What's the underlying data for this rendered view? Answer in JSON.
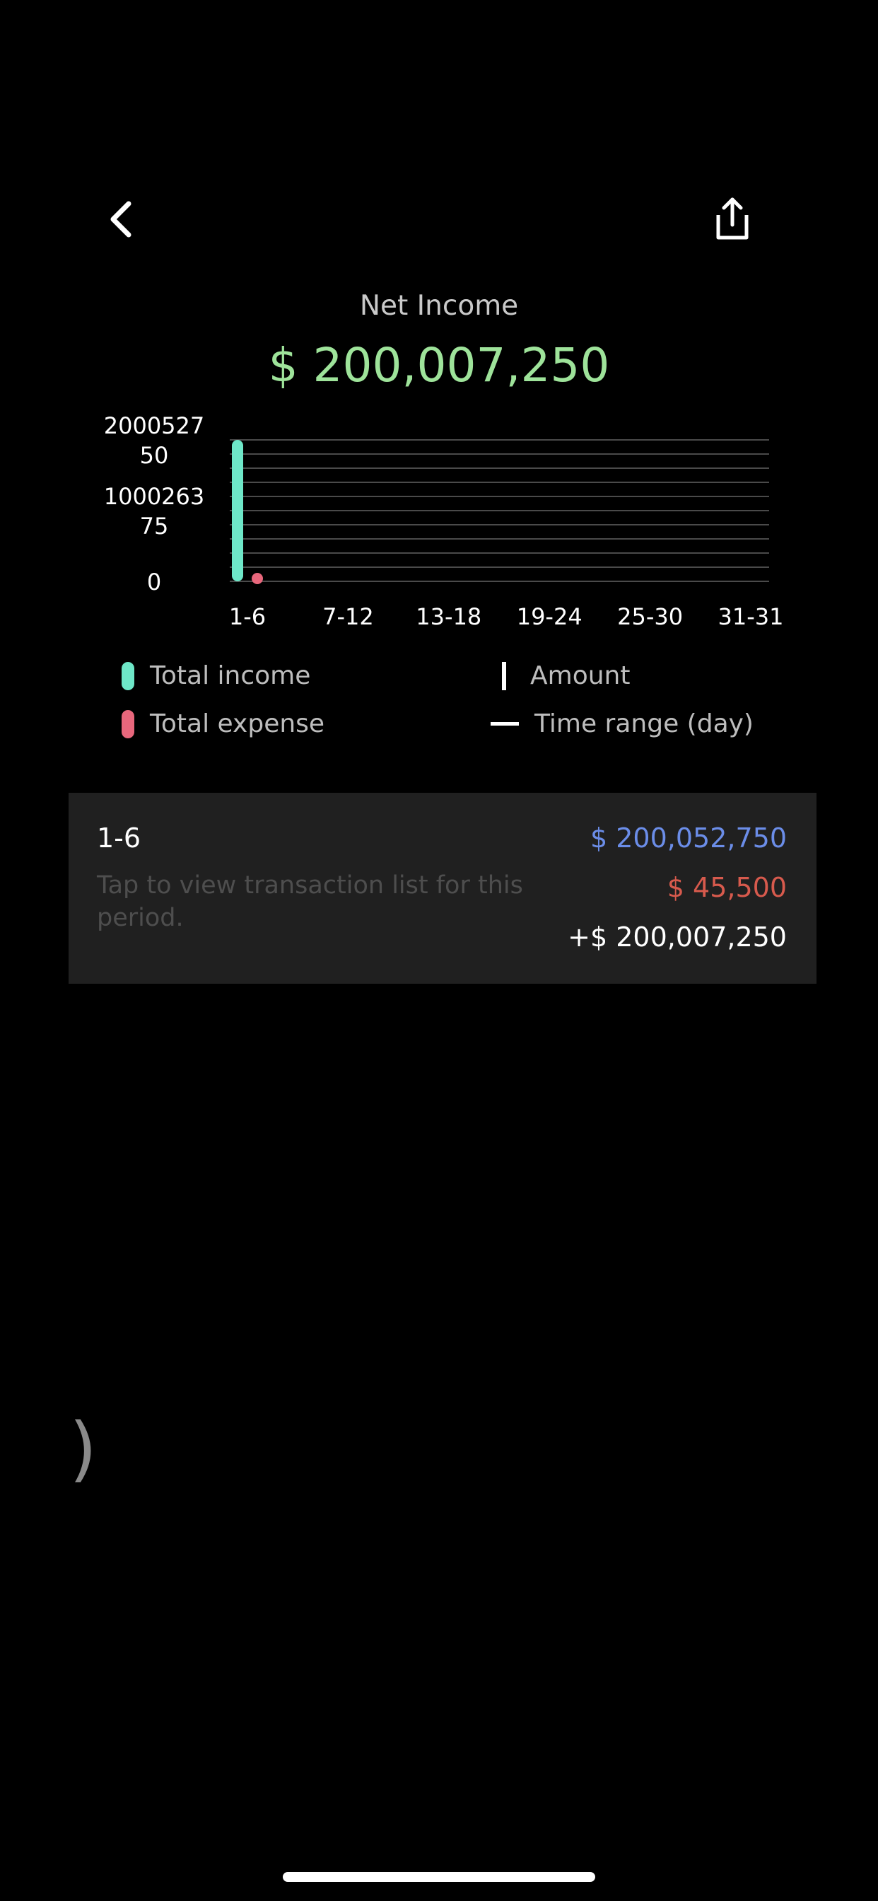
{
  "header": {
    "back_icon": "chevron-left-icon",
    "share_icon": "share-icon"
  },
  "summary": {
    "title": "Net Income",
    "amount": "$ 200,007,250"
  },
  "chart_data": {
    "type": "bar",
    "categories": [
      "1-6",
      "7-12",
      "13-18",
      "19-24",
      "25-30",
      "31-31"
    ],
    "series": [
      {
        "name": "Total income",
        "values": [
          200052750,
          0,
          0,
          0,
          0,
          0
        ],
        "color": "#6ee7c8"
      },
      {
        "name": "Total expense",
        "values": [
          45500,
          0,
          0,
          0,
          0,
          0
        ],
        "color": "#e8677c"
      }
    ],
    "ytick_labels": [
      {
        "value": 200052750,
        "lines": [
          "2000527",
          "50"
        ]
      },
      {
        "value": 100026375,
        "lines": [
          "1000263",
          "75"
        ]
      },
      {
        "value": 0,
        "lines": [
          "0"
        ]
      }
    ],
    "ylim": [
      0,
      200052750
    ],
    "grid": true
  },
  "legend": {
    "income": "Total income",
    "expense": "Total expense",
    "amount": "Amount",
    "time_range": "Time range (day)"
  },
  "period_card": {
    "label": "1-6",
    "hint": "Tap to view transaction list for this period.",
    "income": "$ 200,052,750",
    "expense": "$ 45,500",
    "net": "+$ 200,007,250"
  },
  "misc": {
    "stray_glyph": ")"
  },
  "colors": {
    "background": "#000000",
    "net_amount": "#9ee39a",
    "income": "#6ee7c8",
    "expense": "#e8677c",
    "income_text": "#6b8de8",
    "expense_text": "#d75a4d",
    "card_bg": "#202020"
  }
}
